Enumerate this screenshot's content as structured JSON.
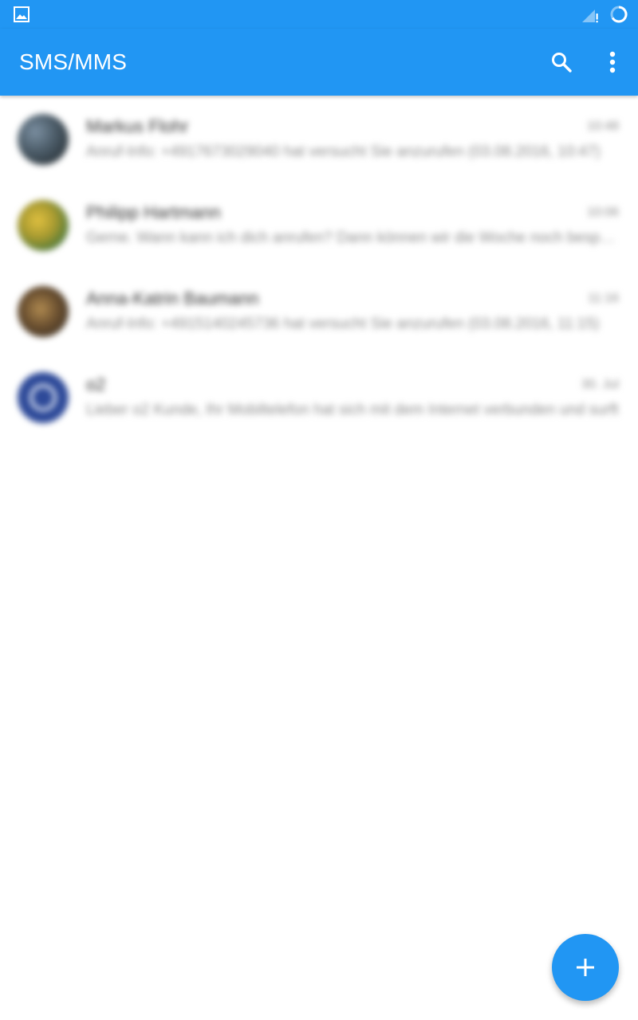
{
  "app": {
    "title": "SMS/MMS",
    "accent_color": "#2196f3"
  },
  "status_bar": {
    "icons": [
      "image-notification-icon",
      "signal-no-data-icon",
      "sync-progress-icon"
    ]
  },
  "toolbar": {
    "search_icon": "search-icon",
    "more_icon": "more-vert-icon"
  },
  "conversations": [
    {
      "name": "Markus Flohr",
      "time": "10:48",
      "preview": "Anruf-Info: +4917673029040 hat versucht Sie anzurufen (03.08.2016, 10:47)",
      "avatar": "photo"
    },
    {
      "name": "Philipp Hartmann",
      "time": "10:06",
      "preview": "Gerne. Wann kann ich dich anrufen? Dann können wir die Woche noch besprechen",
      "avatar": "photo"
    },
    {
      "name": "Anna-Katrin Baumann",
      "time": "11:16",
      "preview": "Anruf-Info: +4915140245736 hat versucht Sie anzurufen (03.08.2016, 11:15)",
      "avatar": "photo"
    },
    {
      "name": "o2",
      "time": "30. Jul",
      "preview": "Lieber o2 Kunde, Ihr Mobiltelefon hat sich mit dem Internet verbunden und surft",
      "avatar": "o2-logo"
    }
  ],
  "fab": {
    "icon": "plus-icon"
  }
}
